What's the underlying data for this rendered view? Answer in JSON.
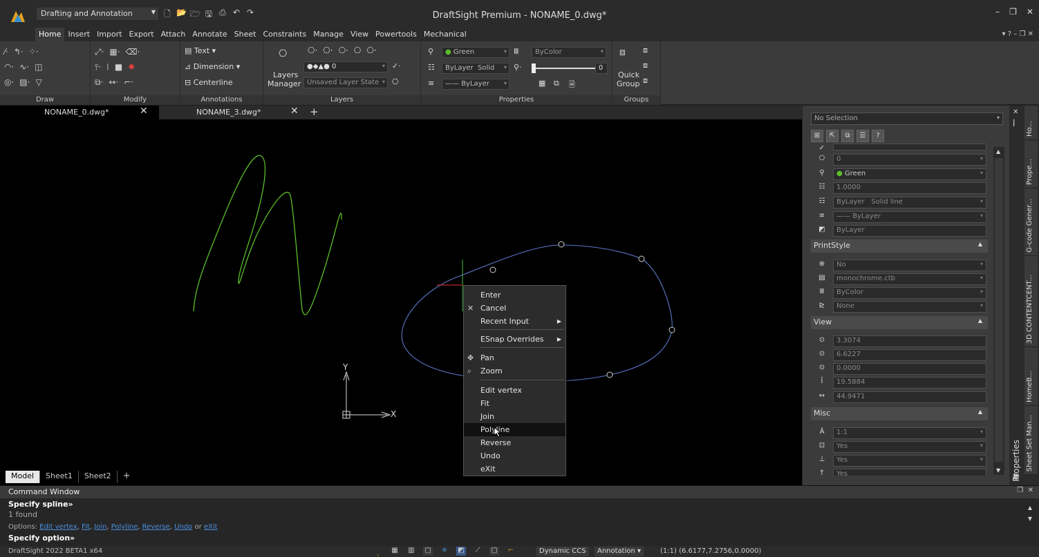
{
  "app": {
    "title": "DraftSight Premium - NONAME_0.dwg*",
    "workspace": "Drafting and Annotation",
    "version": "DraftSight 2022 BETA1  x64"
  },
  "ribbon_tabs": [
    "Home",
    "Insert",
    "Import",
    "Export",
    "Attach",
    "Annotate",
    "Sheet",
    "Constraints",
    "Manage",
    "View",
    "Powertools",
    "Mechanical"
  ],
  "ribbon": {
    "panels": {
      "draw": "Draw",
      "modify": "Modify",
      "annotations": "Annotations",
      "layers": "Layers",
      "properties": "Properties",
      "groups": "Groups"
    },
    "annotations": {
      "text": "Text",
      "dimension": "Dimension",
      "centerline": "Centerline"
    },
    "layers": {
      "manager_line1": "Layers",
      "manager_line2": "Manager",
      "current_layer": "0",
      "layer_state": "Unsaved Layer State"
    },
    "properties": {
      "color": "Green",
      "print_color": "ByColor",
      "linestyle": "ByLayer",
      "linestyle_type": "Solid",
      "lineweight": "ByLayer",
      "transparency": "0"
    },
    "groups": {
      "quick_line1": "Quick",
      "quick_line2": "Group"
    }
  },
  "doc_tabs": [
    "NONAME_0.dwg*",
    "NONAME_3.dwg*"
  ],
  "sheet_tabs": [
    "Model",
    "Sheet1",
    "Sheet2"
  ],
  "ucs": {
    "x": "X",
    "y": "Y"
  },
  "context_menu": [
    {
      "label": "Enter",
      "icon": "",
      "submenu": false
    },
    {
      "label": "Cancel",
      "icon": "✕",
      "submenu": false
    },
    {
      "label": "Recent Input",
      "icon": "",
      "submenu": true
    },
    {
      "label": "ESnap Overrides",
      "icon": "",
      "submenu": true
    },
    {
      "label": "Pan",
      "icon": "✥",
      "submenu": false
    },
    {
      "label": "Zoom",
      "icon": "⌕",
      "submenu": false
    },
    {
      "label": "Edit vertex",
      "icon": "",
      "submenu": false
    },
    {
      "label": "Fit",
      "icon": "",
      "submenu": false
    },
    {
      "label": "Join",
      "icon": "",
      "submenu": false
    },
    {
      "label": "Polyline",
      "icon": "",
      "submenu": false,
      "highlighted": true
    },
    {
      "label": "Reverse",
      "icon": "",
      "submenu": false
    },
    {
      "label": "Undo",
      "icon": "",
      "submenu": false
    },
    {
      "label": "eXit",
      "icon": "",
      "submenu": false
    }
  ],
  "properties_panel": {
    "selection": "No Selection",
    "general": {
      "layer": "0",
      "color": "Green",
      "linescale": "1.0000",
      "linestyle": "ByLayer",
      "linestyle_type": "Solid line",
      "lineweight": "ByLayer",
      "transparency": "ByLayer"
    },
    "printstyle_header": "PrintStyle",
    "printstyle": {
      "first": "No",
      "table": "monochrome.ctb",
      "style": "ByColor",
      "type": "None"
    },
    "view_header": "View",
    "view": [
      "3.3074",
      "6.6227",
      "0.0000",
      "19.5884",
      "44.9471"
    ],
    "misc_header": "Misc",
    "misc": [
      "1:1",
      "Yes",
      "Yes",
      "Yes"
    ]
  },
  "side_tabs": [
    "Ho...",
    "Prope...",
    "G-code Gener...",
    "3D CONTENTCENT...",
    "HomeB...",
    "Sheet Set Man..."
  ],
  "properties_vertical_label": "Properties",
  "command_window": {
    "title": "Command Window",
    "line1": "Specify spline»",
    "line2": "1 found",
    "options_prefix": "Options: ",
    "options": [
      "Edit vertex",
      "Fit",
      "Join",
      "Polyline",
      "Reverse",
      "Undo"
    ],
    "options_or": " or ",
    "options_last": "eXit",
    "prompt": "Specify option»"
  },
  "status_bar": {
    "ccs": "Dynamic CCS",
    "annotation": "Annotation",
    "scale": "(1:1)",
    "coords": "(6.6177,7.2756,0.0000)"
  },
  "colors": {
    "spline_green": "#5cbf2a",
    "spline_blue": "#5a78c8",
    "accent_link": "#4a90e0"
  }
}
